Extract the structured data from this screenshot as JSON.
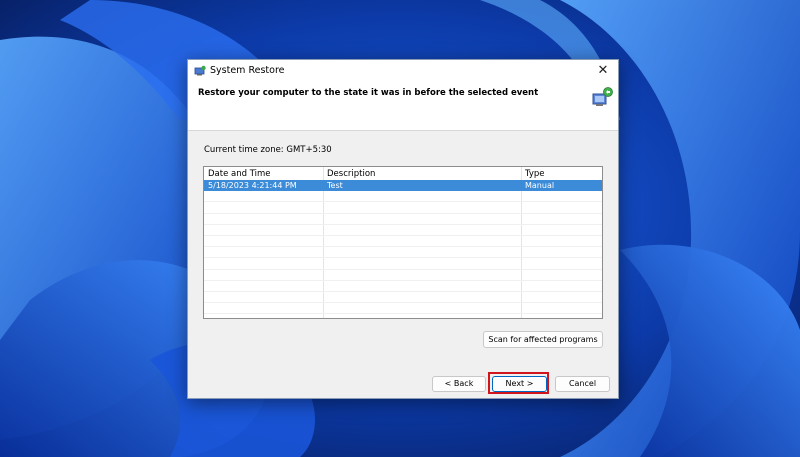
{
  "window": {
    "title": "System Restore",
    "header": "Restore your computer to the state it was in before the selected event",
    "close_symbol": "✕"
  },
  "timezone_label": "Current time zone: GMT+5:30",
  "table": {
    "columns": [
      "Date and Time",
      "Description",
      "Type"
    ],
    "sort_indicator": "ˇ",
    "rows": [
      {
        "date": "5/18/2023 4:21:44 PM",
        "description": "Test",
        "type": "Manual",
        "selected": true
      }
    ]
  },
  "buttons": {
    "scan": "Scan for affected programs",
    "back": "< Back",
    "next": "Next >",
    "cancel": "Cancel"
  },
  "colors": {
    "selection": "#3c8bd9",
    "highlight_box": "#d0161c",
    "wallpaper": "#0a2a7a"
  },
  "icons": [
    "system-restore-icon",
    "close-icon",
    "restore-computer-icon"
  ]
}
